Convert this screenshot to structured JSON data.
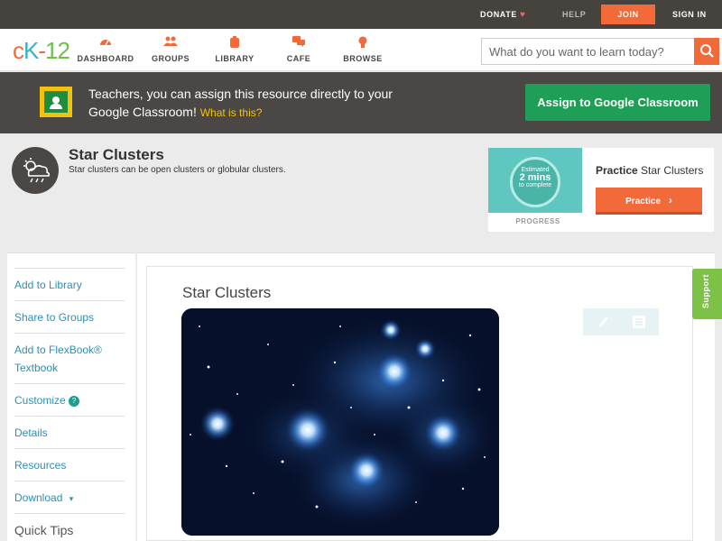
{
  "topbar": {
    "donate": "DONATE",
    "help": "HELP",
    "join": "JOIN",
    "sign_in": "SIGN IN"
  },
  "logo": {
    "c": "c",
    "k": "K",
    "dash": "-",
    "n": "12"
  },
  "nav": {
    "dashboard": "DASHBOARD",
    "groups": "GROUPS",
    "library": "LIBRARY",
    "cafe": "CAFE",
    "browse": "BROWSE"
  },
  "search": {
    "placeholder": "What do you want to learn today?"
  },
  "banner": {
    "text": "Teachers, you can assign this resource directly to your Google Classroom!",
    "link": "What is this?",
    "assign_button": "Assign to Google Classroom"
  },
  "concept": {
    "title": "Star Clusters",
    "subtitle": "Star clusters can be open clusters or globular clusters."
  },
  "practice": {
    "estimated": "Estimated",
    "mins": "2 mins",
    "to_complete": "to complete",
    "progress_label": "PROGRESS",
    "title_bold": "Practice",
    "title_rest": "Star Clusters",
    "button": "Practice"
  },
  "sidebar": {
    "items": [
      {
        "label": "Add to Library"
      },
      {
        "label": "Share to Groups"
      },
      {
        "label": "Add to FlexBook® Textbook"
      },
      {
        "label": "Customize"
      },
      {
        "label": "Details"
      },
      {
        "label": "Resources"
      },
      {
        "label": "Download"
      },
      {
        "label": "Quick Tips"
      }
    ],
    "help_glyph": "?",
    "download_caret": "▾"
  },
  "content": {
    "title": "Star Clusters"
  },
  "support": {
    "label": "Support"
  },
  "colors": {
    "accent": "#f26a3a",
    "topbar_bg": "#46433f",
    "banner_bg": "#4a4744",
    "assign_green": "#1e9e57",
    "link_blue": "#2d8fb3",
    "support_green": "#7dc246"
  }
}
